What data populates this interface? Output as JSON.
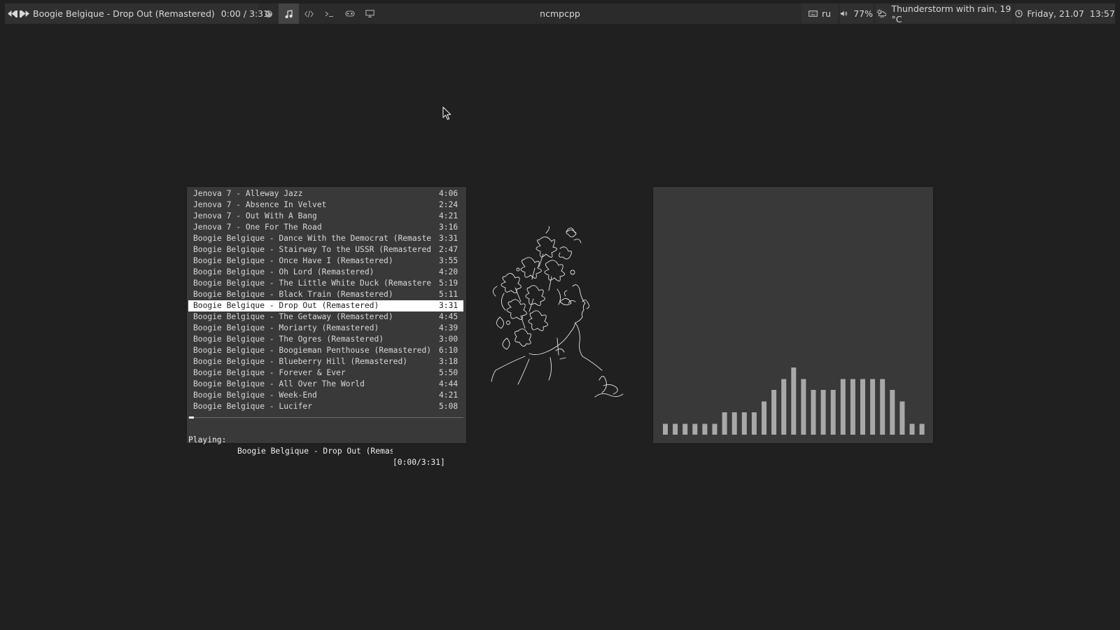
{
  "topbar": {
    "now_playing": "Boogie Belgique - Drop Out (Remastered)",
    "time": "0:00 / 3:31",
    "window_title": "ncmpcpp",
    "keyboard_layout": "ru",
    "volume": "77%",
    "weather": "Thunderstorm with rain, 19 °C",
    "clock": "Friday, 21.07  13:57",
    "icons": {
      "prev": "previous-icon",
      "pause": "pause-icon",
      "next": "next-icon",
      "tags": [
        "globe-icon",
        "music-note-icon",
        "code-icon",
        "terminal-icon",
        "gamepad-icon",
        "monitor-icon"
      ],
      "active_tag": 1
    }
  },
  "playlist": {
    "selected_index": 10,
    "rows": [
      {
        "title": "Jenova 7 - Alleway Jazz",
        "duration": "4:06"
      },
      {
        "title": "Jenova 7 - Absence In Velvet",
        "duration": "2:24"
      },
      {
        "title": "Jenova 7 - Out With A Bang",
        "duration": "4:21"
      },
      {
        "title": "Jenova 7 - One For The Road",
        "duration": "3:16"
      },
      {
        "title": "Boogie Belgique - Dance With the Democrat (Remaste",
        "duration": "3:31"
      },
      {
        "title": "Boogie Belgique - Stairway To the USSR (Remastered",
        "duration": "2:47"
      },
      {
        "title": "Boogie Belgique - Once Have I (Remastered)",
        "duration": "3:55"
      },
      {
        "title": "Boogie Belgique - Oh Lord (Remastered)",
        "duration": "4:20"
      },
      {
        "title": "Boogie Belgique - The Little White Duck (Remastere",
        "duration": "5:19"
      },
      {
        "title": "Boogie Belgique - Black Train (Remastered)",
        "duration": "5:11"
      },
      {
        "title": "Boogie Belgique - Drop Out (Remastered)",
        "duration": "3:31"
      },
      {
        "title": "Boogie Belgique - The Getaway (Remastered)",
        "duration": "4:45"
      },
      {
        "title": "Boogie Belgique - Moriarty (Remastered)",
        "duration": "4:39"
      },
      {
        "title": "Boogie Belgique - The Ogres (Remastered)",
        "duration": "3:00"
      },
      {
        "title": "Boogie Belgique - Boogieman Penthouse (Remastered)",
        "duration": "6:10"
      },
      {
        "title": "Boogie Belgique - Blueberry Hill (Remastered)",
        "duration": "3:18"
      },
      {
        "title": "Boogie Belgique - Forever & Ever",
        "duration": "5:50"
      },
      {
        "title": "Boogie Belgique - All Over The World",
        "duration": "4:44"
      },
      {
        "title": "Boogie Belgique - Week-End",
        "duration": "4:21"
      },
      {
        "title": "Boogie Belgique - Lucifer",
        "duration": "5:08"
      }
    ],
    "progress": 0.0
  },
  "statusline": {
    "label": "Playing:",
    "song": "Boogie Belgique - Drop Out (Remast",
    "time": "[0:00/3:31]"
  },
  "visualizer": {
    "levels": [
      0.16,
      0.16,
      0.16,
      0.16,
      0.16,
      0.16,
      0.33,
      0.33,
      0.33,
      0.33,
      0.49,
      0.66,
      0.82,
      0.99,
      0.82,
      0.66,
      0.66,
      0.66,
      0.82,
      0.82,
      0.82,
      0.82,
      0.82,
      0.66,
      0.49,
      0.16,
      0.16
    ],
    "bar_color": "#a8a8a8"
  }
}
